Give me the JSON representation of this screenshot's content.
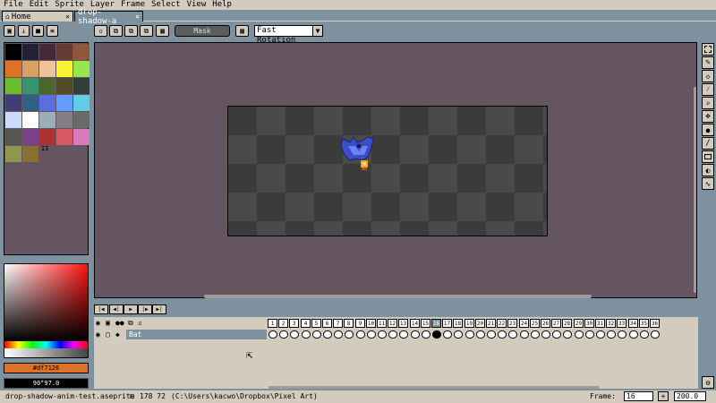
{
  "menubar": {
    "items": [
      {
        "label": "File"
      },
      {
        "label": "Edit"
      },
      {
        "label": "Sprite"
      },
      {
        "label": "Layer"
      },
      {
        "label": "Frame"
      },
      {
        "label": "Select"
      },
      {
        "label": "View"
      },
      {
        "label": "Help"
      }
    ]
  },
  "tabs": {
    "home": {
      "label": "Home"
    },
    "file": {
      "label": "drop-shadow-a"
    }
  },
  "contextbar": {
    "mask_label": "Mask",
    "rotation_value": "Fast Rotation"
  },
  "palette": {
    "colors": [
      "#000000",
      "#222034",
      "#45283c",
      "#663931",
      "#8f563b",
      "#df7126",
      "#d9a066",
      "#eec39a",
      "#fbf236",
      "#99e550",
      "#6abe30",
      "#37946e",
      "#4b692f",
      "#524b24",
      "#323c39",
      "#3f3f74",
      "#306082",
      "#5b6ee1",
      "#639bff",
      "#5fcde4",
      "#cbdbfc",
      "#ffffff",
      "#9badb7",
      "#847e87",
      "#696a6a",
      "#595652",
      "#76428a",
      "#ac3232",
      "#d95763",
      "#d77bba",
      "#8f974a",
      "#8a6f30"
    ],
    "extra_glyph": "II"
  },
  "color": {
    "hex": "#df7126",
    "hsv": "90°97.0"
  },
  "playback": {
    "buttons": [
      "first-frame",
      "previous-frame",
      "play",
      "next-frame",
      "last-frame"
    ]
  },
  "timeline": {
    "layer_name": "Bat",
    "frames": [
      "1",
      "2",
      "3",
      "4",
      "5",
      "6",
      "7",
      "8",
      "9",
      "10",
      "11",
      "12",
      "13",
      "14",
      "15",
      "16",
      "17",
      "18",
      "19",
      "20",
      "21",
      "22",
      "23",
      "24",
      "25",
      "26",
      "27",
      "28",
      "29",
      "30",
      "31",
      "32",
      "33",
      "34",
      "35",
      "36"
    ],
    "selected_frame": "16"
  },
  "statusbar": {
    "filename": "drop-shadow-anim-test.aseprite",
    "size": "178 72",
    "path": "(C:\\Users\\kacwo\\Dropbox\\Pixel Art)",
    "frame_label": "Frame:",
    "frame_value": "16",
    "plus": "+",
    "zoom": "200.0"
  },
  "colors": {
    "ui_bg": "#7d929e",
    "panel": "#d3cbbe",
    "editor_bg": "#655561"
  }
}
